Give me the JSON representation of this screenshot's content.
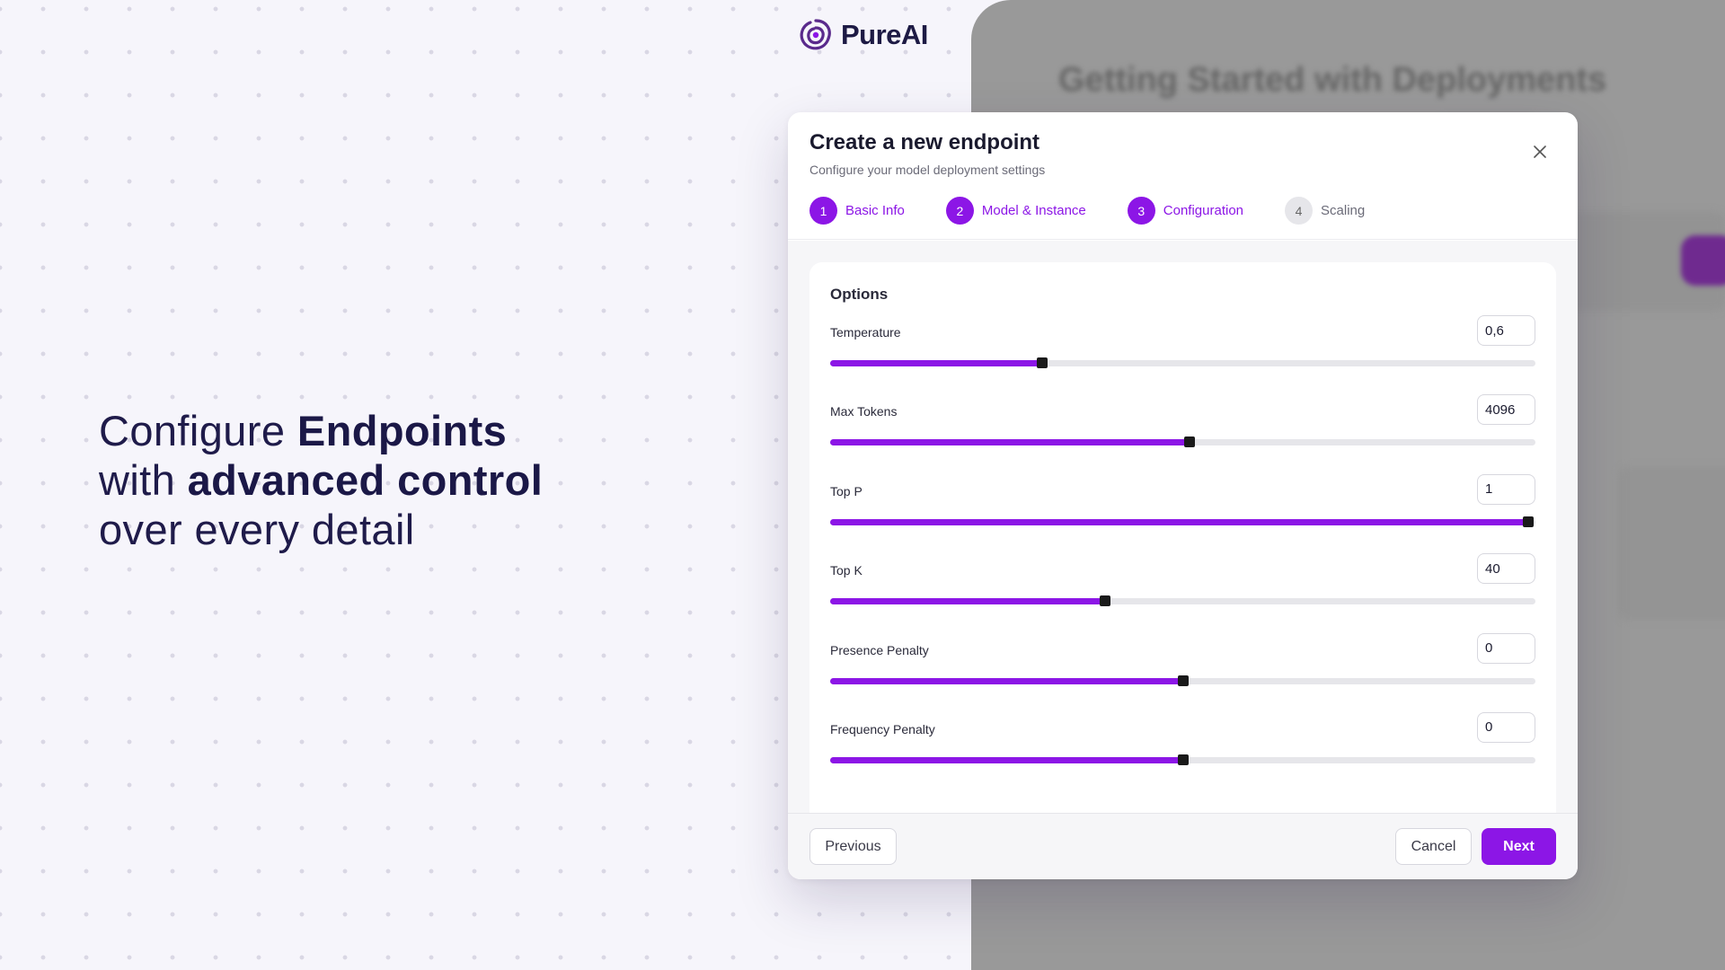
{
  "brand": {
    "name": "PureAI",
    "logo_icon": "swirl-logo-icon",
    "accent": "#8c16e6"
  },
  "headline": {
    "line1_pre": "Configure ",
    "line1_bold": "Endpoints",
    "line2_pre": "with ",
    "line2_bold": "advanced control",
    "line3": "over every detail"
  },
  "background": {
    "title": "Getting Started with Deployments"
  },
  "modal": {
    "title": "Create a new endpoint",
    "subtitle": "Configure your model deployment settings",
    "close_icon": "close-icon",
    "steps": [
      {
        "number": "1",
        "label": "Basic Info",
        "state": "done"
      },
      {
        "number": "2",
        "label": "Model & Instance",
        "state": "done"
      },
      {
        "number": "3",
        "label": "Configuration",
        "state": "active"
      },
      {
        "number": "4",
        "label": "Scaling",
        "state": "pending"
      }
    ],
    "options": {
      "title": "Options",
      "items": [
        {
          "label": "Temperature",
          "value": "0,6",
          "fraction": 0.3
        },
        {
          "label": "Max Tokens",
          "value": "4096",
          "fraction": 0.51
        },
        {
          "label": "Top P",
          "value": "1",
          "fraction": 0.99
        },
        {
          "label": "Top K",
          "value": "40",
          "fraction": 0.39
        },
        {
          "label": "Presence Penalty",
          "value": "0",
          "fraction": 0.5
        },
        {
          "label": "Frequency Penalty",
          "value": "0",
          "fraction": 0.5
        }
      ]
    },
    "footer": {
      "previous": "Previous",
      "cancel": "Cancel",
      "next": "Next"
    }
  }
}
